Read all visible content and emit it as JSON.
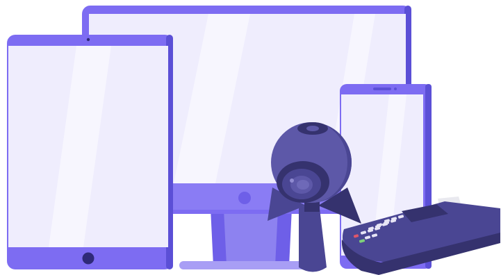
{
  "illustration": {
    "devices": [
      {
        "kind": "desktop-monitor"
      },
      {
        "kind": "tablet"
      },
      {
        "kind": "smartphone"
      },
      {
        "kind": "webcam"
      },
      {
        "kind": "card-payment-terminal"
      }
    ],
    "icons": [
      "monitor-icon",
      "tablet-icon",
      "smartphone-icon",
      "webcam-icon",
      "payment-terminal-icon"
    ]
  },
  "colors": {
    "frame": "#7D6CF2",
    "frame_dark": "#5B4FD6",
    "screen": "#EFEDFD",
    "screen_glare": "#F7F6FE",
    "stand": "#6E5FE8",
    "stand_light": "#A89EF5",
    "device_dark": "#4A4693",
    "device_darker": "#35326E",
    "device_mid": "#5D58A8",
    "key_light": "#E7E5F5",
    "key_red": "#E0566A",
    "key_green": "#7ED07A",
    "paper": "#E9E9EF",
    "home_button": "#2F2A78"
  }
}
